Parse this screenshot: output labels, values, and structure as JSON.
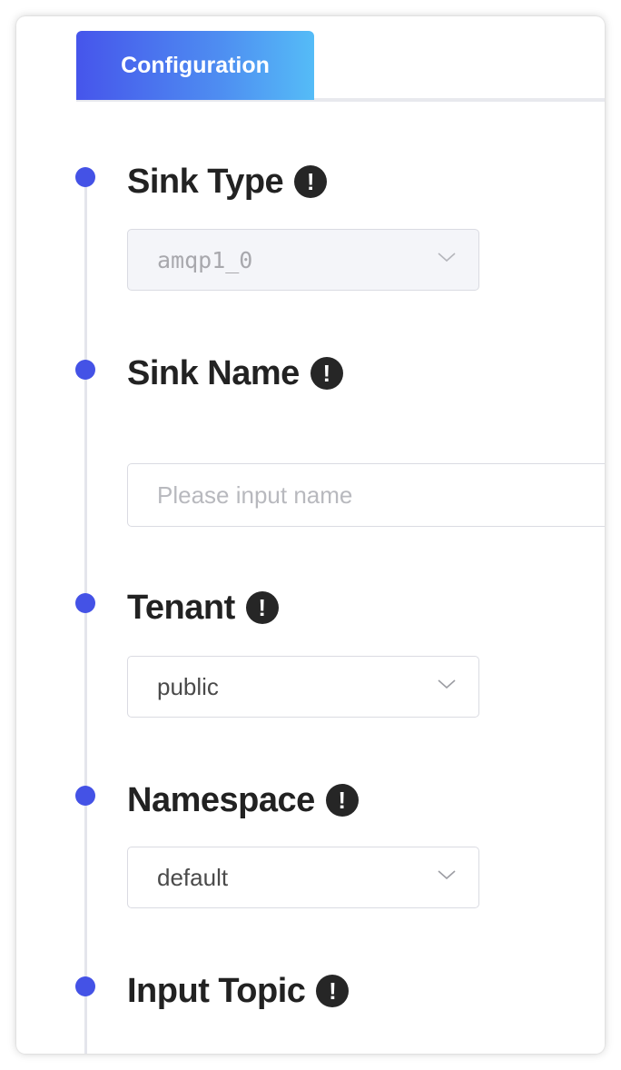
{
  "tabs": [
    {
      "label": "Configuration",
      "active": true
    }
  ],
  "colors": {
    "accent": "#4452e6",
    "tab_gradient_start": "#4655eb",
    "tab_gradient_end": "#55bcf7",
    "timeline": "#e4e5ec"
  },
  "form": {
    "sink_type": {
      "label": "Sink Type",
      "info_icon": "exclamation-circle-icon",
      "value": "amqp1_0",
      "disabled": true
    },
    "sink_name": {
      "label": "Sink Name",
      "info_icon": "exclamation-circle-icon",
      "value": "",
      "placeholder": "Please input name"
    },
    "tenant": {
      "label": "Tenant",
      "info_icon": "exclamation-circle-icon",
      "value": "public"
    },
    "namespace": {
      "label": "Namespace",
      "info_icon": "exclamation-circle-icon",
      "value": "default"
    },
    "input_topic": {
      "label": "Input Topic",
      "info_icon": "exclamation-circle-icon"
    }
  }
}
